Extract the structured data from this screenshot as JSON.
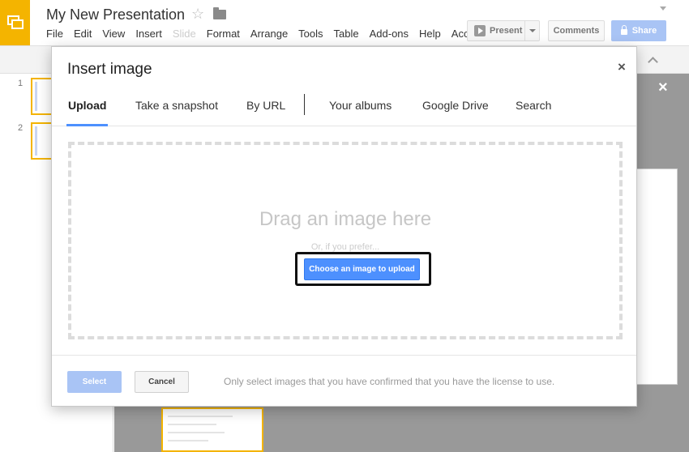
{
  "app": {
    "title": "My New Presentation",
    "menu": [
      "File",
      "Edit",
      "View",
      "Insert",
      "Slide",
      "Format",
      "Arrange",
      "Tools",
      "Table",
      "Add-ons",
      "Help",
      "Acc"
    ],
    "present_label": "Present",
    "comments_label": "Comments",
    "share_label": "Share"
  },
  "slides": {
    "numbers": [
      "1",
      "2"
    ]
  },
  "dialog": {
    "title": "Insert image",
    "close_label": "×",
    "tabs": [
      "Upload",
      "Take a snapshot",
      "By URL",
      "Your albums",
      "Google Drive",
      "Search"
    ],
    "active_tab": "Upload",
    "drop_title": "Drag an image here",
    "drop_subtitle": "Or, if you prefer...",
    "choose_label": "Choose an image to upload",
    "select_label": "Select",
    "cancel_label": "Cancel",
    "license_note": "Only select images that you have confirmed that you have the license to use."
  },
  "overlay": {
    "close_label": "×"
  },
  "colors": {
    "accent_blue": "#4d90fe",
    "disabled_blue": "#a9c4f5",
    "brand_yellow": "#f4b400",
    "canvas_gray": "#999999"
  }
}
